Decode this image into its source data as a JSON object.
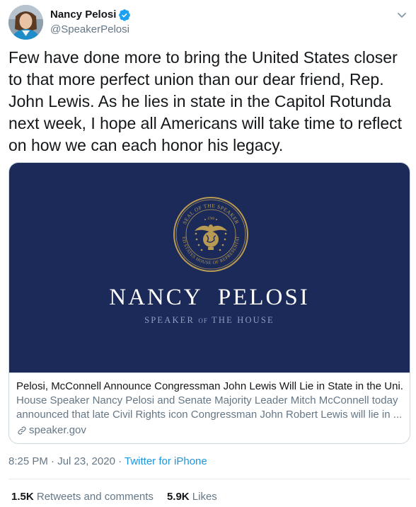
{
  "user": {
    "display_name": "Nancy Pelosi",
    "handle": "@SpeakerPelosi",
    "verified": true
  },
  "tweet": {
    "text_lines": [
      "Few have done more to bring the United States closer",
      "to that more perfect union than our dear friend, Rep.",
      "John Lewis. As he lies in state in the Capitol Rotunda",
      "next week, I hope all Americans will take time to reflect",
      "on how we can each honor his legacy."
    ]
  },
  "card": {
    "brand_name": "NANCY  PELOSI",
    "brand_sub_pre": "SPEAKER ",
    "brand_sub_of": "OF",
    "brand_sub_post": " THE HOUSE",
    "seal_top_text": "SEAL OF THE SPEAKER",
    "seal_side_text": "UNITED STATES HOUSE OF REPRESENTATIVES",
    "seal_year": "1789",
    "title": "Pelosi, McConnell Announce Congressman John Lewis Will Lie in State in the Uni...",
    "description": "House Speaker Nancy Pelosi and Senate Majority Leader Mitch McConnell today announced that late Civil Rights icon Congressman John Robert Lewis will lie in ...",
    "description_line1": "House Speaker Nancy Pelosi and Senate Majority Leader Mitch McConnell today",
    "description_line2": "announced that late Civil Rights icon Congressman John Robert Lewis will lie in ...",
    "domain": "speaker.gov"
  },
  "meta": {
    "time": "8:25 PM · Jul 23, 2020",
    "separator": " · ",
    "source": "Twitter for iPhone"
  },
  "stats": {
    "retweets_count": "1.5K",
    "retweets_label": " Retweets and comments",
    "likes_count": "5.9K",
    "likes_label": " Likes"
  },
  "colors": {
    "card_background": "#1b2a59",
    "seal_gold": "#b89a52",
    "link_blue": "#1b95e0",
    "verified_blue": "#1da1f2"
  },
  "icons": [
    "avatar",
    "verified-badge-icon",
    "chevron-down-icon",
    "link-icon",
    "speaker-seal-icon"
  ]
}
